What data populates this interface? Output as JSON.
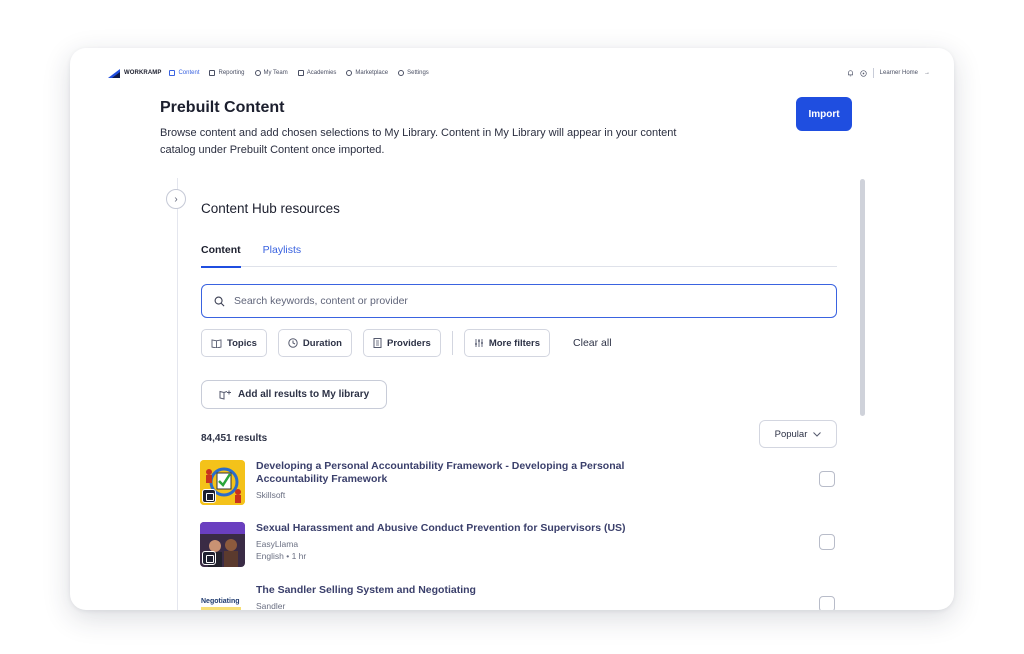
{
  "nav": {
    "brand": "WORKRAMP",
    "items": [
      {
        "label": "Content",
        "icon": "content-icon",
        "active": true
      },
      {
        "label": "Reporting",
        "icon": "reporting-icon",
        "active": false
      },
      {
        "label": "My Team",
        "icon": "team-icon",
        "active": false
      },
      {
        "label": "Academies",
        "icon": "academies-icon",
        "active": false
      },
      {
        "label": "Marketplace",
        "icon": "marketplace-icon",
        "active": false
      },
      {
        "label": "Settings",
        "icon": "settings-icon",
        "active": false
      }
    ],
    "learner_home": "Learner Home",
    "accent": "#3a63e0"
  },
  "header": {
    "title": "Prebuilt Content",
    "description": "Browse content and add chosen selections to My Library. Content in My Library will appear in your content catalog under Prebuilt Content once imported.",
    "import_label": "Import"
  },
  "hub": {
    "title": "Content Hub resources",
    "tabs": [
      {
        "label": "Content",
        "active": true
      },
      {
        "label": "Playlists",
        "active": false
      }
    ],
    "search_placeholder": "Search keywords, content or provider",
    "filters": [
      {
        "label": "Topics",
        "icon": "book-icon"
      },
      {
        "label": "Duration",
        "icon": "clock-icon"
      },
      {
        "label": "Providers",
        "icon": "building-icon"
      },
      {
        "label": "More filters",
        "icon": "sliders-icon"
      }
    ],
    "clear_all": "Clear all",
    "add_all_label": "Add all results to My library",
    "results_count": "84,451 results",
    "sort_label": "Popular"
  },
  "results": [
    {
      "title": "Developing a Personal Accountability Framework - Developing a Personal Accountability Framework",
      "provider": "Skillsoft",
      "sub": "",
      "thumb": "accountability"
    },
    {
      "title": "Sexual Harassment and Abusive Conduct Prevention for Supervisors (US)",
      "provider": "EasyLlama",
      "sub": "English • 1 hr",
      "thumb": "harassment"
    },
    {
      "title": "The Sandler Selling System and Negotiating",
      "provider": "Sandler",
      "sub": "",
      "thumb": "negotiating"
    }
  ],
  "thumb_text": {
    "negotiating": "Negotiating"
  }
}
